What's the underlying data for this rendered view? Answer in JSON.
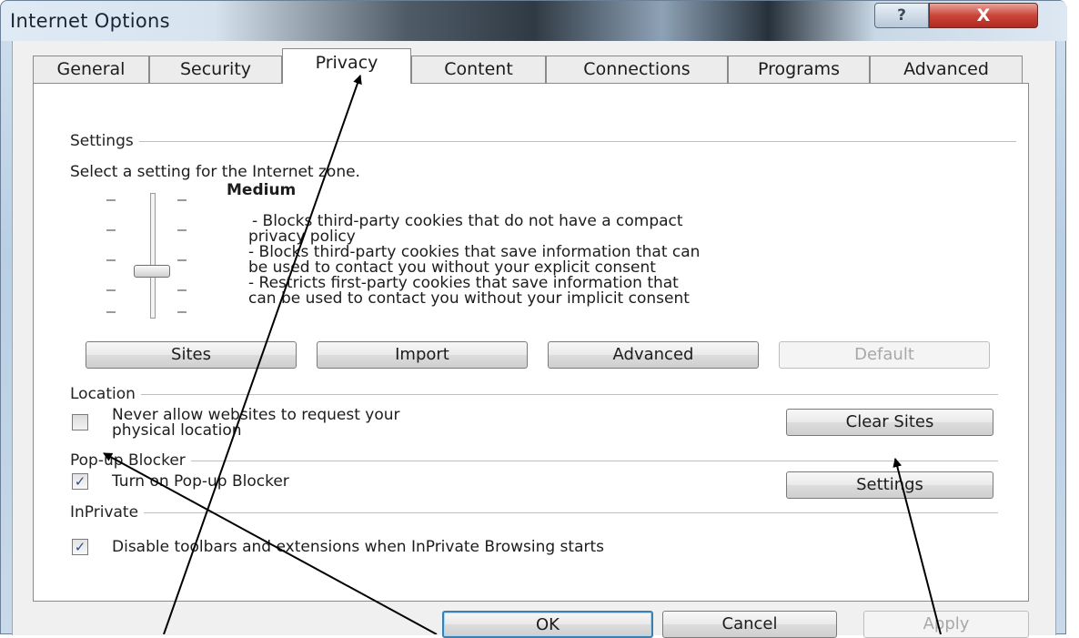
{
  "window": {
    "title": "Internet Options",
    "help_label": "?",
    "close_label": "X"
  },
  "tabs": [
    {
      "label": "General",
      "active": false
    },
    {
      "label": "Security",
      "active": false
    },
    {
      "label": "Privacy",
      "active": true
    },
    {
      "label": "Content",
      "active": false
    },
    {
      "label": "Connections",
      "active": false
    },
    {
      "label": "Programs",
      "active": false
    },
    {
      "label": "Advanced",
      "active": false
    }
  ],
  "settings": {
    "group_label": "Settings",
    "prompt": "Select a setting for the Internet zone.",
    "level": "Medium",
    "description": [
      "- Blocks third-party cookies that do not have a compact",
      "privacy policy",
      "- Blocks third-party cookies that save information that can",
      "be used to contact you without your explicit consent",
      "- Restricts first-party cookies that save information that",
      "can be used to contact you without your implicit consent"
    ],
    "buttons": {
      "sites": "Sites",
      "import": "Import",
      "advanced": "Advanced",
      "default": "Default"
    }
  },
  "location": {
    "group_label": "Location",
    "checkbox_label_line1": "Never allow websites to request your",
    "checkbox_label_line2": "physical location",
    "checked": false,
    "clear_sites": "Clear Sites"
  },
  "popup": {
    "group_label": "Pop-up Blocker",
    "checkbox_label": "Turn on Pop-up Blocker",
    "checked": true,
    "settings": "Settings"
  },
  "inprivate": {
    "group_label": "InPrivate",
    "checkbox_label": "Disable toolbars and extensions when InPrivate Browsing starts",
    "checked": true
  },
  "footer": {
    "ok": "OK",
    "cancel": "Cancel",
    "apply": "Apply"
  },
  "check_glyph": "✓"
}
